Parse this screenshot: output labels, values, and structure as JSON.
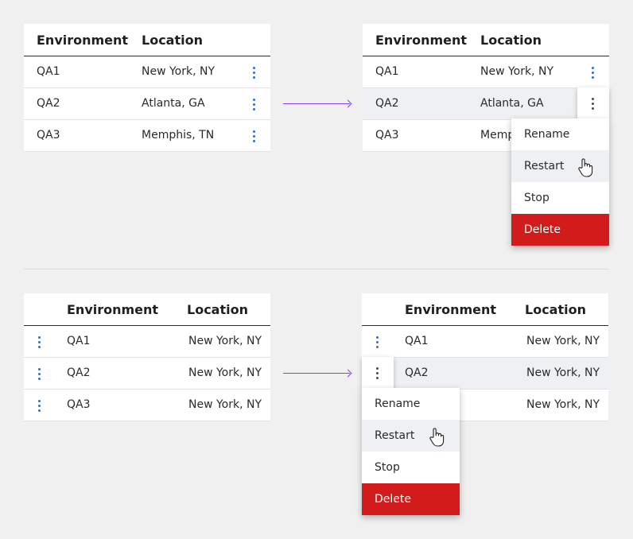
{
  "columns": {
    "environment": "Environment",
    "location": "Location"
  },
  "table_top": [
    {
      "env": "QA1",
      "loc": "New York, NY"
    },
    {
      "env": "QA2",
      "loc": "Atlanta, GA"
    },
    {
      "env": "QA3",
      "loc": "Memphis, TN"
    }
  ],
  "table_top_right_truncated": "Memph",
  "table_bottom": [
    {
      "env": "QA1",
      "loc": "New York, NY"
    },
    {
      "env": "QA2",
      "loc": "New York, NY"
    },
    {
      "env": "QA3",
      "loc": "New York, NY"
    }
  ],
  "menu": {
    "rename": "Rename",
    "restart": "Restart",
    "stop": "Stop",
    "delete": "Delete"
  },
  "colors": {
    "accent_kebab": "#2d6fc2",
    "arrow": "#8a3ff0",
    "danger": "#d21c1c",
    "highlight": "#eef0f3"
  },
  "icons": {
    "kebab": "more-vertical-icon",
    "cursor": "hand-pointer-icon",
    "arrow": "arrow-right-icon"
  }
}
